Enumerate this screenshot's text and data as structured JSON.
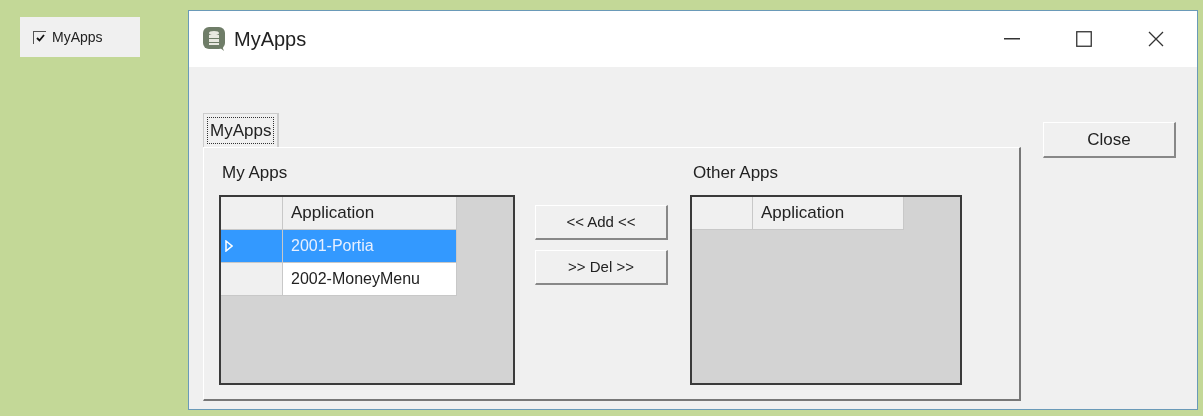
{
  "side_item": {
    "label": "MyApps",
    "checked": true
  },
  "window": {
    "title": "MyApps"
  },
  "tabs": [
    {
      "label": "MyApps",
      "selected": true
    }
  ],
  "my_apps": {
    "label": "My Apps",
    "columns": [
      "Application"
    ],
    "rows": [
      {
        "application": "2001-Portia",
        "selected": true
      },
      {
        "application": "2002-MoneyMenu",
        "selected": false
      }
    ]
  },
  "buttons": [
    "<< Add <<",
    ">> Del >>"
  ],
  "other_apps": {
    "label": "Other Apps",
    "columns": [
      "Application"
    ]
  },
  "close_button": "Close"
}
